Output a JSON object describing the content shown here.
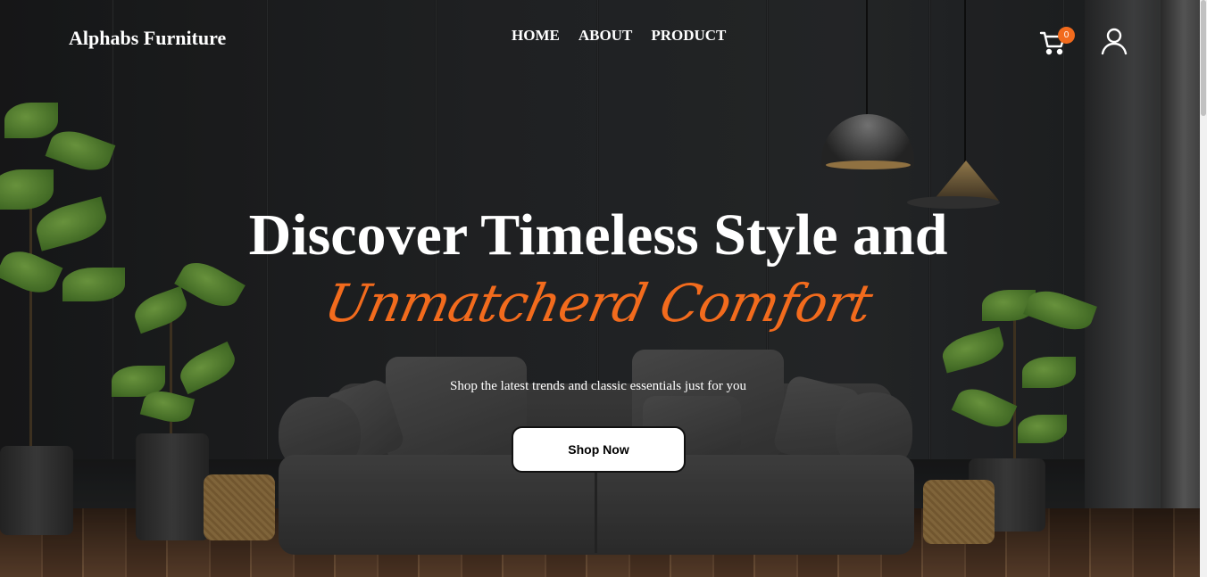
{
  "header": {
    "brand": "Alphabs Furniture",
    "nav": [
      "HOME",
      "ABOUT",
      "PRODUCT"
    ],
    "cart_count": "0",
    "cart_icon": "cart-icon",
    "user_icon": "user-icon"
  },
  "hero": {
    "title": "Discover Timeless Style and",
    "script": "Unmatcherd Comfort",
    "subtitle": "Shop the latest trends and classic essentials just for you",
    "cta": "Shop Now"
  },
  "colors": {
    "accent": "#f26b1d",
    "text": "#ffffff"
  }
}
